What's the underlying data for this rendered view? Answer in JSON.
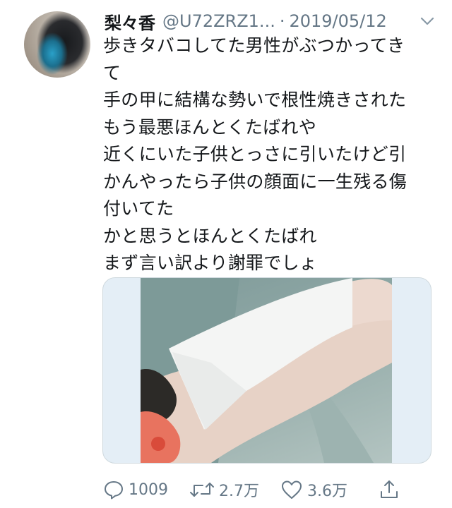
{
  "tweet": {
    "author_name": "梨々香",
    "author_handle": "@U72ZRZ1...",
    "separator": "·",
    "date": "2019/05/12",
    "lines": [
      "歩きタバコしてた男性がぶつかってき",
      "て",
      "手の甲に結構な勢いで根性焼きされた",
      "もう最悪ほんとくたばれや",
      "近くにいた子供とっさに引いたけど引",
      "かんやったら子供の顔面に一生残る傷",
      "付いてた",
      "かと思うとほんとくたばれ",
      "まず言い訳より謝罪でしょ"
    ],
    "icons": {
      "menu": "chevron-down-icon",
      "reply": "speech-bubble-icon",
      "retweet": "retweet-arrows-icon",
      "like": "heart-outline-icon",
      "share": "upload-arrow-icon"
    },
    "stats": {
      "replies": "1009",
      "retweets": "2.7万",
      "likes": "3.6万"
    },
    "colors": {
      "text": "#14171a",
      "muted": "#657786",
      "media_border": "#cfd9de"
    }
  }
}
